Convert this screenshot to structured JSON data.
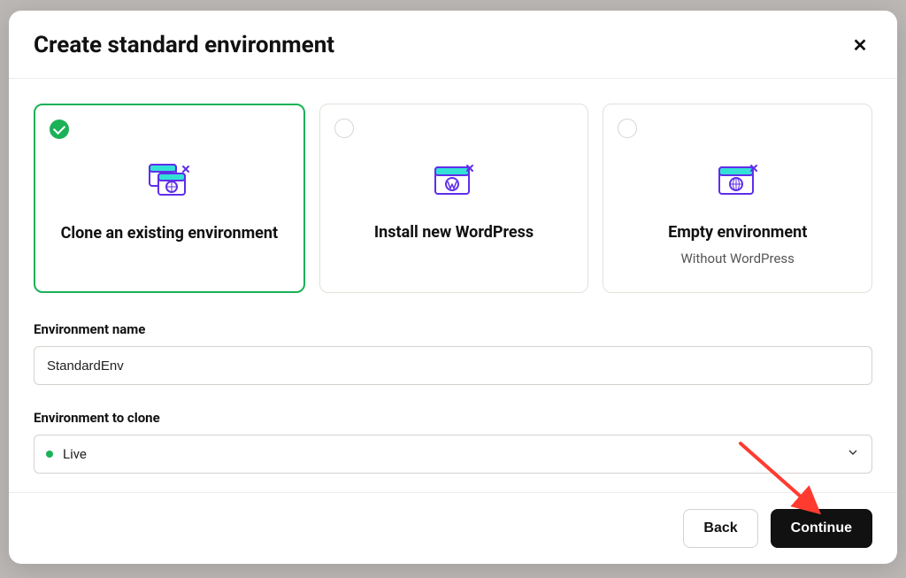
{
  "modal": {
    "title": "Create standard environment",
    "close_label": "✕"
  },
  "options": [
    {
      "title": "Clone an existing environment",
      "subtitle": "",
      "selected": true
    },
    {
      "title": "Install new WordPress",
      "subtitle": "",
      "selected": false
    },
    {
      "title": "Empty environment",
      "subtitle": "Without WordPress",
      "selected": false
    }
  ],
  "fields": {
    "env_name_label": "Environment name",
    "env_name_value": "StandardEnv",
    "clone_label": "Environment to clone",
    "clone_value": "Live"
  },
  "footer": {
    "back": "Back",
    "continue": "Continue"
  },
  "colors": {
    "accent_green": "#1bb157",
    "primary_black": "#111111"
  }
}
